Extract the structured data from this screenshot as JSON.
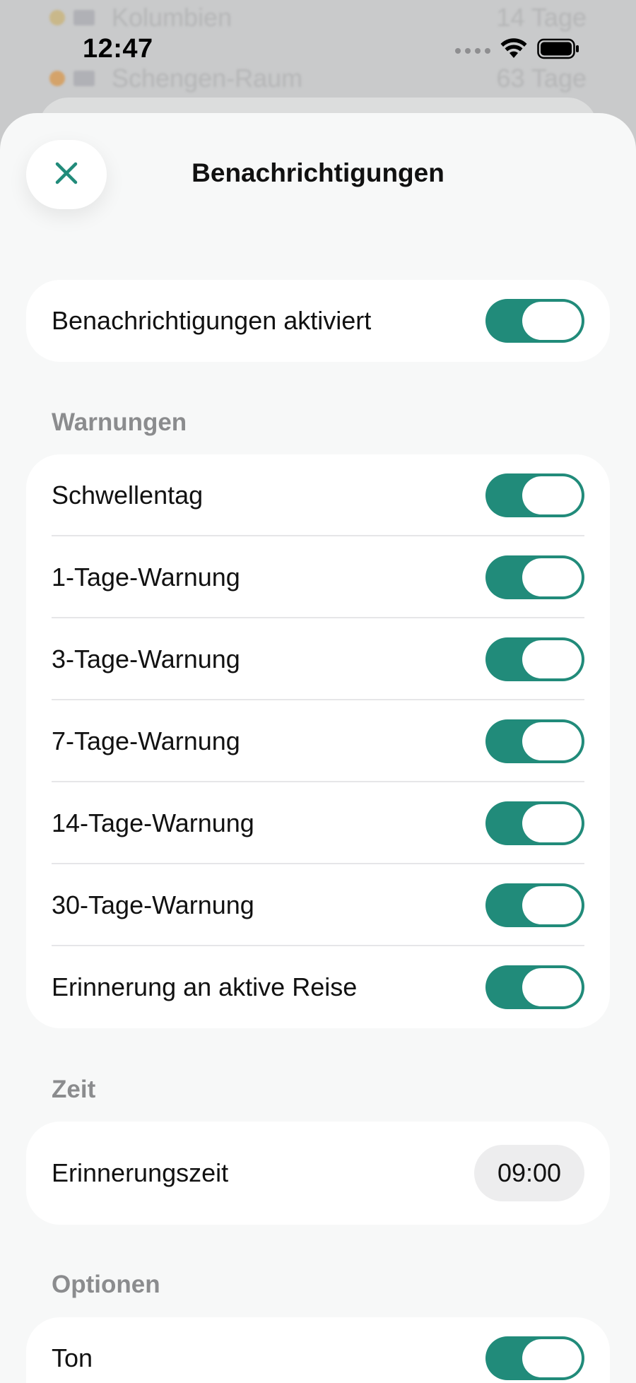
{
  "background_list": [
    {
      "name": "Kolumbien",
      "days": "14 Tage"
    },
    {
      "name": "Schengen-Raum",
      "days": "63 Tage"
    }
  ],
  "status_bar": {
    "time": "12:47"
  },
  "sheet": {
    "title": "Benachrichtigungen",
    "close_icon": "close-x-icon"
  },
  "master": {
    "label": "Benachrichtigungen aktiviert",
    "enabled": true
  },
  "warnings": {
    "header": "Warnungen",
    "items": [
      {
        "label": "Schwellentag",
        "enabled": true
      },
      {
        "label": "1-Tage-Warnung",
        "enabled": true
      },
      {
        "label": "3-Tage-Warnung",
        "enabled": true
      },
      {
        "label": "7-Tage-Warnung",
        "enabled": true
      },
      {
        "label": "14-Tage-Warnung",
        "enabled": true
      },
      {
        "label": "30-Tage-Warnung",
        "enabled": true
      },
      {
        "label": "Erinnerung an aktive Reise",
        "enabled": true
      }
    ]
  },
  "time_section": {
    "header": "Zeit",
    "label": "Erinnerungszeit",
    "value": "09:00"
  },
  "options": {
    "header": "Optionen",
    "items": [
      {
        "label": "Ton",
        "enabled": true
      }
    ]
  },
  "colors": {
    "accent": "#218b7a",
    "sheet_background": "#f7f8f8",
    "card_background": "#ffffff",
    "section_header": "#8b8c8e"
  }
}
